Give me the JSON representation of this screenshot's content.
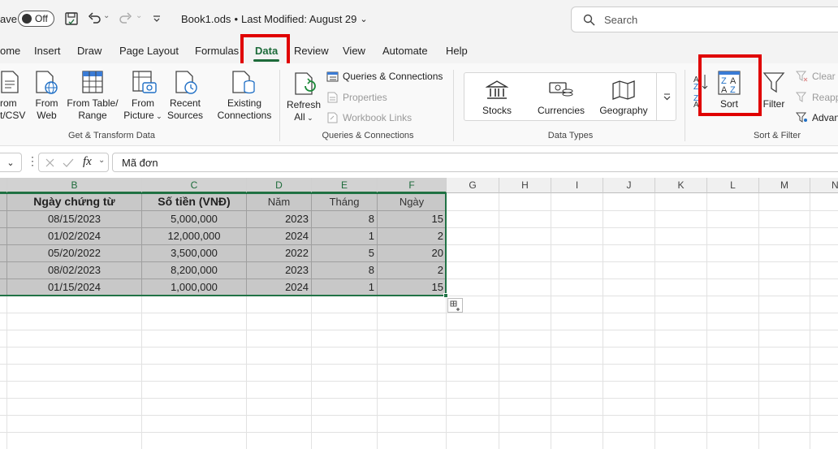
{
  "titlebar": {
    "autosave_label": "ave",
    "toggle_label": "Off",
    "file_title": "Book1.ods",
    "separator": "•",
    "last_modified": "Last Modified: August 29",
    "search_placeholder": "Search"
  },
  "tabs": [
    "ome",
    "Insert",
    "Draw",
    "Page Layout",
    "Formulas",
    "Data",
    "Review",
    "View",
    "Automate",
    "Help"
  ],
  "active_tab": "Data",
  "ribbon": {
    "get_transform": {
      "from_text_l1": "rom",
      "from_text_l2": "t/CSV",
      "from_web_l1": "From",
      "from_web_l2": "Web",
      "from_table_l1": "From Table/",
      "from_table_l2": "Range",
      "from_picture_l1": "From",
      "from_picture_l2": "Picture",
      "recent_l1": "Recent",
      "recent_l2": "Sources",
      "existing_l1": "Existing",
      "existing_l2": "Connections",
      "group_label": "Get & Transform Data"
    },
    "queries": {
      "refresh_l1": "Refresh",
      "refresh_l2": "All",
      "queries_connections": "Queries & Connections",
      "properties": "Properties",
      "workbook_links": "Workbook Links",
      "group_label": "Queries & Connections"
    },
    "data_types": {
      "stocks": "Stocks",
      "currencies": "Currencies",
      "geography": "Geography",
      "group_label": "Data Types"
    },
    "sort_filter": {
      "sort": "Sort",
      "filter": "Filter",
      "clear": "Clear",
      "reapply": "Reapp",
      "advanced": "Advan",
      "group_label": "Sort & Filter"
    }
  },
  "formula_bar": {
    "fx": "fx",
    "value": "Mã đơn"
  },
  "columns": [
    "A",
    "B",
    "C",
    "D",
    "E",
    "F",
    "G",
    "H",
    "I",
    "J",
    "K",
    "L",
    "M",
    "N"
  ],
  "table": {
    "headers": [
      "Ngày chứng từ",
      "Số tiền (VNĐ)",
      "Năm",
      "Tháng",
      "Ngày"
    ],
    "rows": [
      [
        "08/15/2023",
        "5,000,000",
        "2023",
        "8",
        "15"
      ],
      [
        "01/02/2024",
        "12,000,000",
        "2024",
        "1",
        "2"
      ],
      [
        "05/20/2022",
        "3,500,000",
        "2022",
        "5",
        "20"
      ],
      [
        "08/02/2023",
        "8,200,000",
        "2023",
        "8",
        "2"
      ],
      [
        "01/15/2024",
        "1,000,000",
        "2024",
        "1",
        "15"
      ]
    ]
  },
  "colors": {
    "selection_fill": "#c8c8c8",
    "selection_border": "#217346",
    "highlight": "#e00000"
  }
}
